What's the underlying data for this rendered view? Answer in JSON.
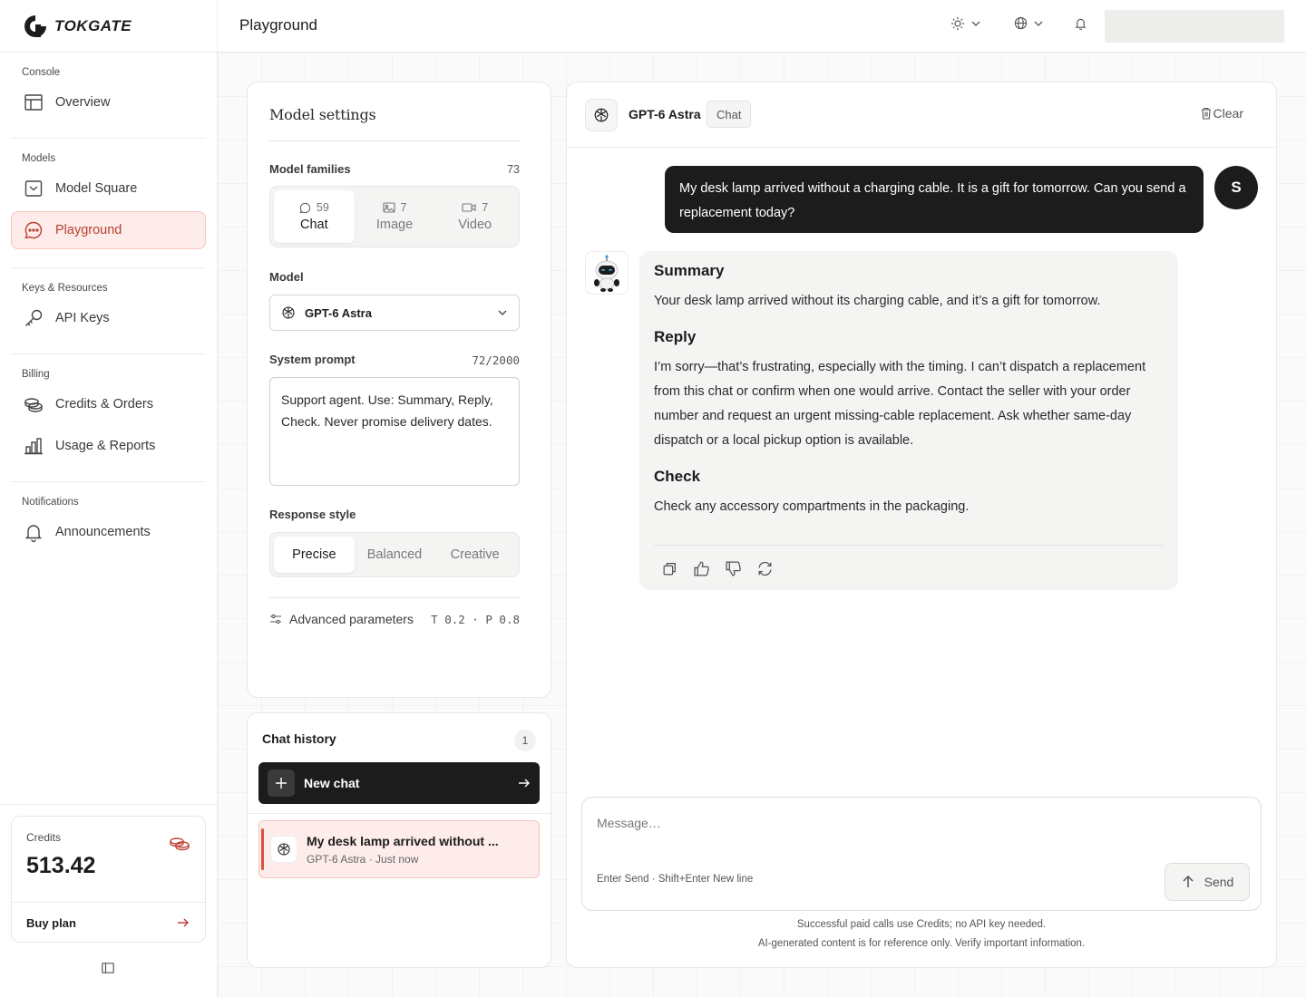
{
  "app": {
    "name": "TOKGATE"
  },
  "sidebar": {
    "groups": [
      {
        "title": "Console",
        "items": [
          {
            "label": "Overview"
          }
        ]
      },
      {
        "title": "Models",
        "items": [
          {
            "label": "Model Square"
          },
          {
            "label": "Playground"
          }
        ]
      },
      {
        "title": "Keys & Resources",
        "items": [
          {
            "label": "API Keys"
          }
        ]
      },
      {
        "title": "Billing",
        "items": [
          {
            "label": "Credits & Orders"
          },
          {
            "label": "Usage & Reports"
          }
        ]
      },
      {
        "title": "Notifications",
        "items": [
          {
            "label": "Announcements"
          }
        ]
      }
    ],
    "active_item": "Playground",
    "credits": {
      "label": "Credits",
      "value": "513.42",
      "buy_label": "Buy plan"
    }
  },
  "header": {
    "title": "Playground"
  },
  "settings": {
    "title": "Model settings",
    "families_label": "Model families",
    "families_count": "73",
    "families": [
      {
        "label": "Chat",
        "count": "59",
        "icon": "chat-bubble-icon"
      },
      {
        "label": "Image",
        "count": "7",
        "icon": "image-icon"
      },
      {
        "label": "Video",
        "count": "7",
        "icon": "video-icon"
      }
    ],
    "model_label": "Model",
    "model_value": "GPT-6 Astra",
    "system_prompt_label": "System prompt",
    "system_prompt_count": "72/2000",
    "system_prompt_value": "Support agent. Use: Summary, Reply, Check. Never promise delivery dates.",
    "response_style_label": "Response style",
    "response_styles": [
      "Precise",
      "Balanced",
      "Creative"
    ],
    "advanced_label": "Advanced parameters",
    "advanced_value": "T 0.2 · P 0.8"
  },
  "history": {
    "title": "Chat history",
    "count": "1",
    "new_chat_label": "New chat",
    "items": [
      {
        "title": "My desk lamp arrived without ...",
        "subtitle": "GPT-6 Astra · Just now"
      }
    ]
  },
  "chat": {
    "model_name": "GPT-6 Astra",
    "model_tag": "Chat",
    "clear_label": "Clear",
    "user_initial": "S",
    "user_message": "My desk lamp arrived without a charging cable. It is a gift for tomorrow. Can you send a replacement today?",
    "reply": {
      "summary_title": "Summary",
      "summary_text": "Your desk lamp arrived without its charging cable, and it’s a gift for tomorrow.",
      "reply_title": "Reply",
      "reply_text": "I’m sorry—that’s frustrating, especially with the timing. I can’t dispatch a replacement from this chat or confirm when one would arrive. Contact the seller with your order number and request an urgent missing-cable replacement. Ask whether same-day dispatch or a local pickup option is available.",
      "check_title": "Check",
      "check_text": "Check any accessory compartments in the packaging."
    },
    "composer": {
      "placeholder": "Message…",
      "hint": "Enter Send · Shift+Enter New line",
      "send_label": "Send"
    },
    "footer_line1": "Successful paid calls use Credits; no API key needed.",
    "footer_line2": "AI-generated content is for reference only. Verify important information."
  },
  "colors": {
    "accent": "#b8402f",
    "accent_bg": "#fdecea",
    "dark": "#1c1c1c"
  }
}
